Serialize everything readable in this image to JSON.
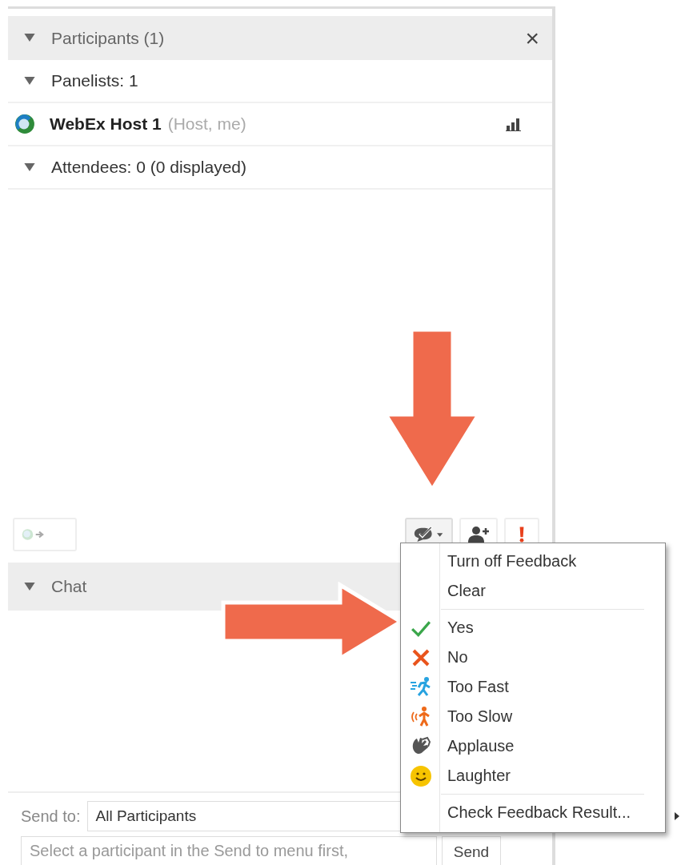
{
  "participants": {
    "title": "Participants (1)",
    "close": "×",
    "expanded": true,
    "groups": [
      {
        "label": "Panelists: 1",
        "expanded": true,
        "members": [
          {
            "name": "WebEx Host 1",
            "role": "(Host, me)"
          }
        ]
      },
      {
        "label": "Attendees: 0 (0 displayed)",
        "expanded": true
      }
    ]
  },
  "toolbar": {
    "feedback_menu_open": true
  },
  "chat": {
    "title": "Chat",
    "expanded": true,
    "send_to_label": "Send to:",
    "send_to_value": "All Participants",
    "message_placeholder": "Select a participant in the Send to menu first,",
    "send_button": "Send"
  },
  "feedback_menu": {
    "sections": [
      [
        {
          "label": "Turn off Feedback",
          "kind": "text"
        },
        {
          "label": "Clear",
          "kind": "text"
        }
      ],
      [
        {
          "label": "Yes",
          "kind": "feedback"
        },
        {
          "label": "No",
          "kind": "feedback"
        },
        {
          "label": "Too Fast",
          "kind": "feedback"
        },
        {
          "label": "Too Slow",
          "kind": "feedback"
        },
        {
          "label": "Applause",
          "kind": "feedback"
        },
        {
          "label": "Laughter",
          "kind": "feedback"
        }
      ],
      [
        {
          "label": "Check Feedback Result...",
          "kind": "text"
        }
      ]
    ]
  }
}
